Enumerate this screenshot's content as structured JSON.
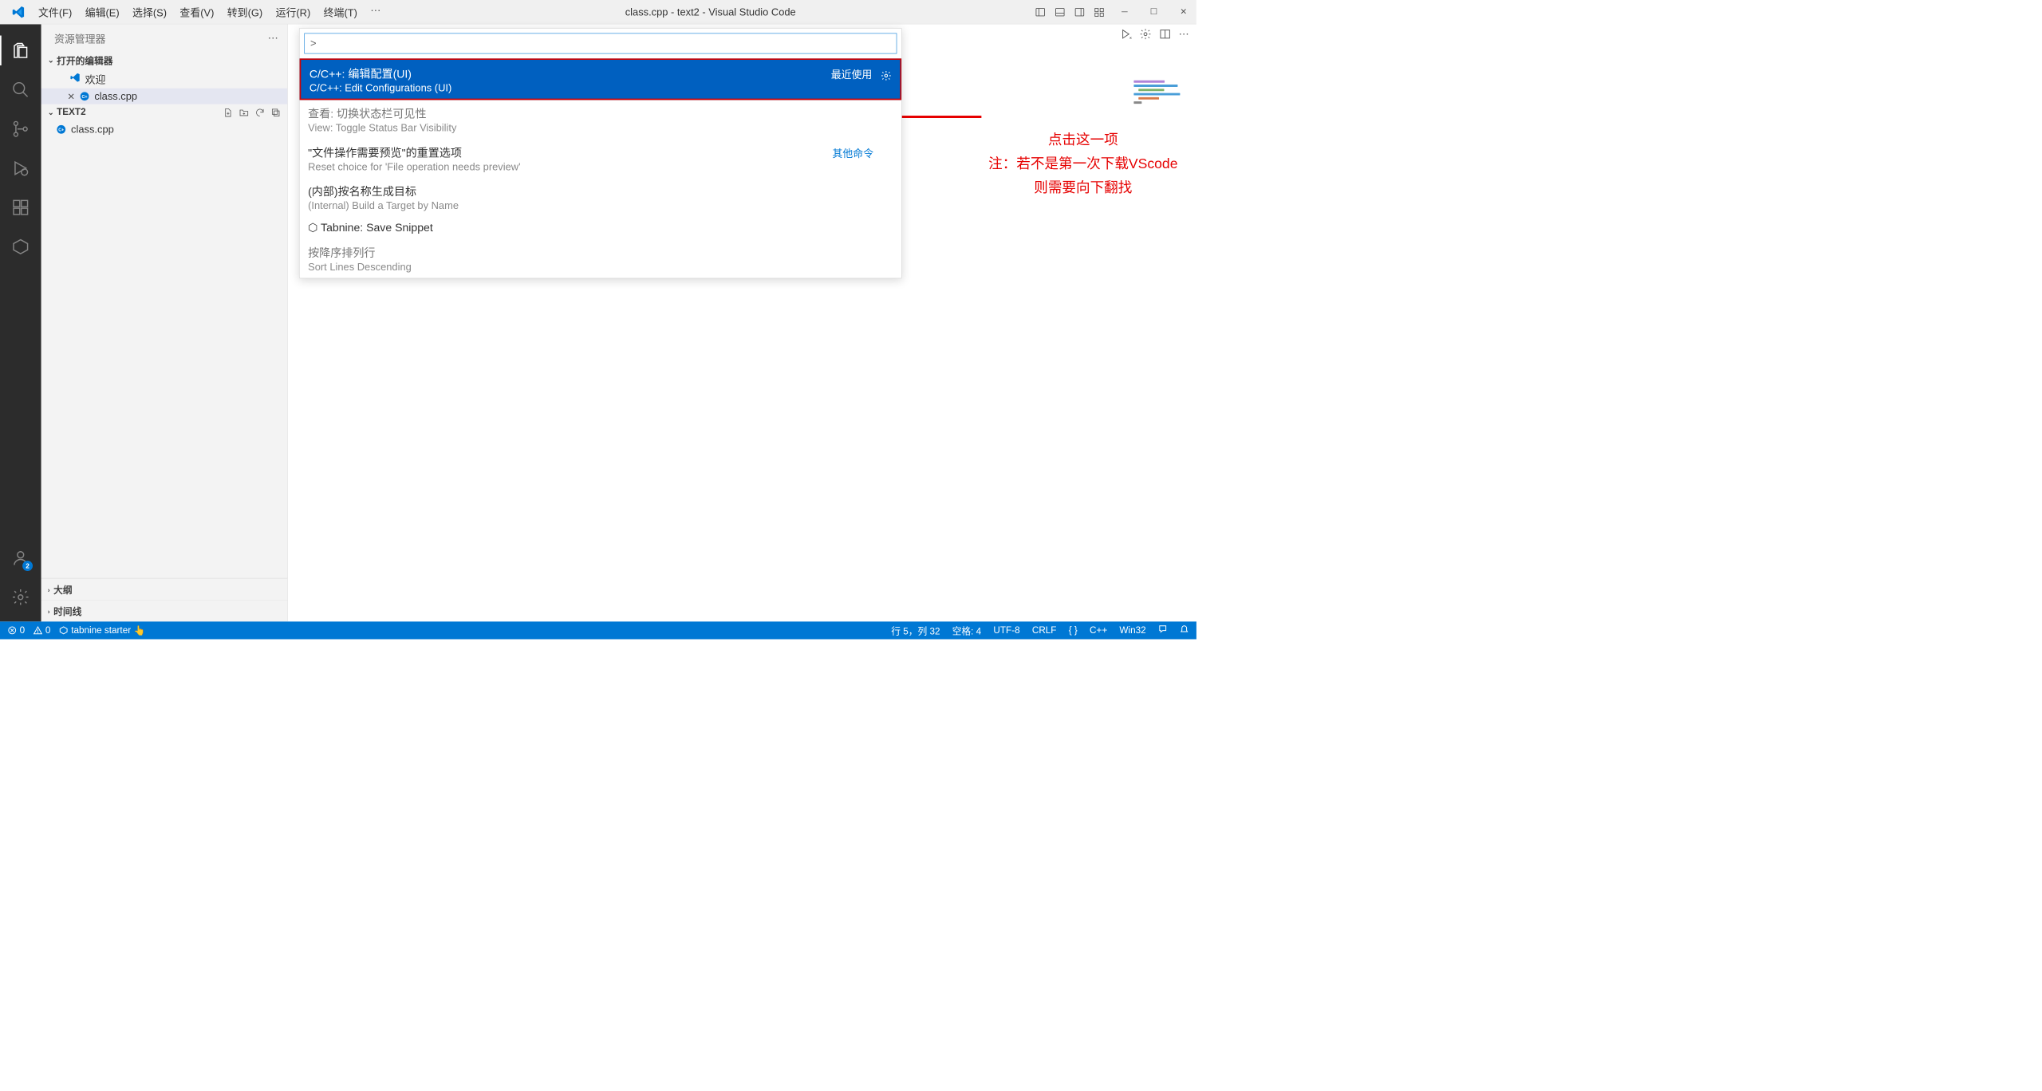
{
  "title": "class.cpp - text2 - Visual Studio Code",
  "menu": {
    "file": "文件(F)",
    "edit": "编辑(E)",
    "select": "选择(S)",
    "view": "查看(V)",
    "go": "转到(G)",
    "run": "运行(R)",
    "terminal": "终端(T)",
    "more": "⋯"
  },
  "sidebar": {
    "title": "资源管理器",
    "openEditors": "打开的编辑器",
    "welcome": "欢迎",
    "openFile": "class.cpp",
    "folder": "TEXT2",
    "file": "class.cpp",
    "outline": "大纲",
    "timeline": "时间线"
  },
  "palette": {
    "input": ">",
    "items": [
      {
        "primary": "C/C++: 编辑配置(UI)",
        "secondary": "C/C++: Edit Configurations (UI)",
        "badge": "最近使用",
        "selected": true,
        "gear": true
      },
      {
        "primary": "查看: 切换状态栏可见性",
        "secondary": "View: Toggle Status Bar Visibility",
        "dim": true
      },
      {
        "primary": "\"文件操作需要预览\"的重置选项",
        "secondary": "Reset choice for 'File operation needs preview'",
        "badge": "其他命令",
        "badgeBlue": true
      },
      {
        "primary": "(内部)按名称生成目标",
        "secondary": "(Internal) Build a Target by Name"
      },
      {
        "primary": "⬡ Tabnine: Save Snippet",
        "secondary": ""
      },
      {
        "primary": "按降序排列行",
        "secondary": "Sort Lines Descending",
        "dim": true
      }
    ]
  },
  "annotation": {
    "line1": "点击这一项",
    "line2": "注：若不是第一次下载VScode",
    "line3": "则需要向下翻找"
  },
  "status": {
    "errors": "0",
    "warnings": "0",
    "tabnine": "tabnine starter",
    "hand": "👆",
    "cursor": "行 5，列 32",
    "spaces": "空格: 4",
    "encoding": "UTF-8",
    "eol": "CRLF",
    "braces": "{ }",
    "lang": "C++",
    "platform": "Win32"
  },
  "badge": "2"
}
